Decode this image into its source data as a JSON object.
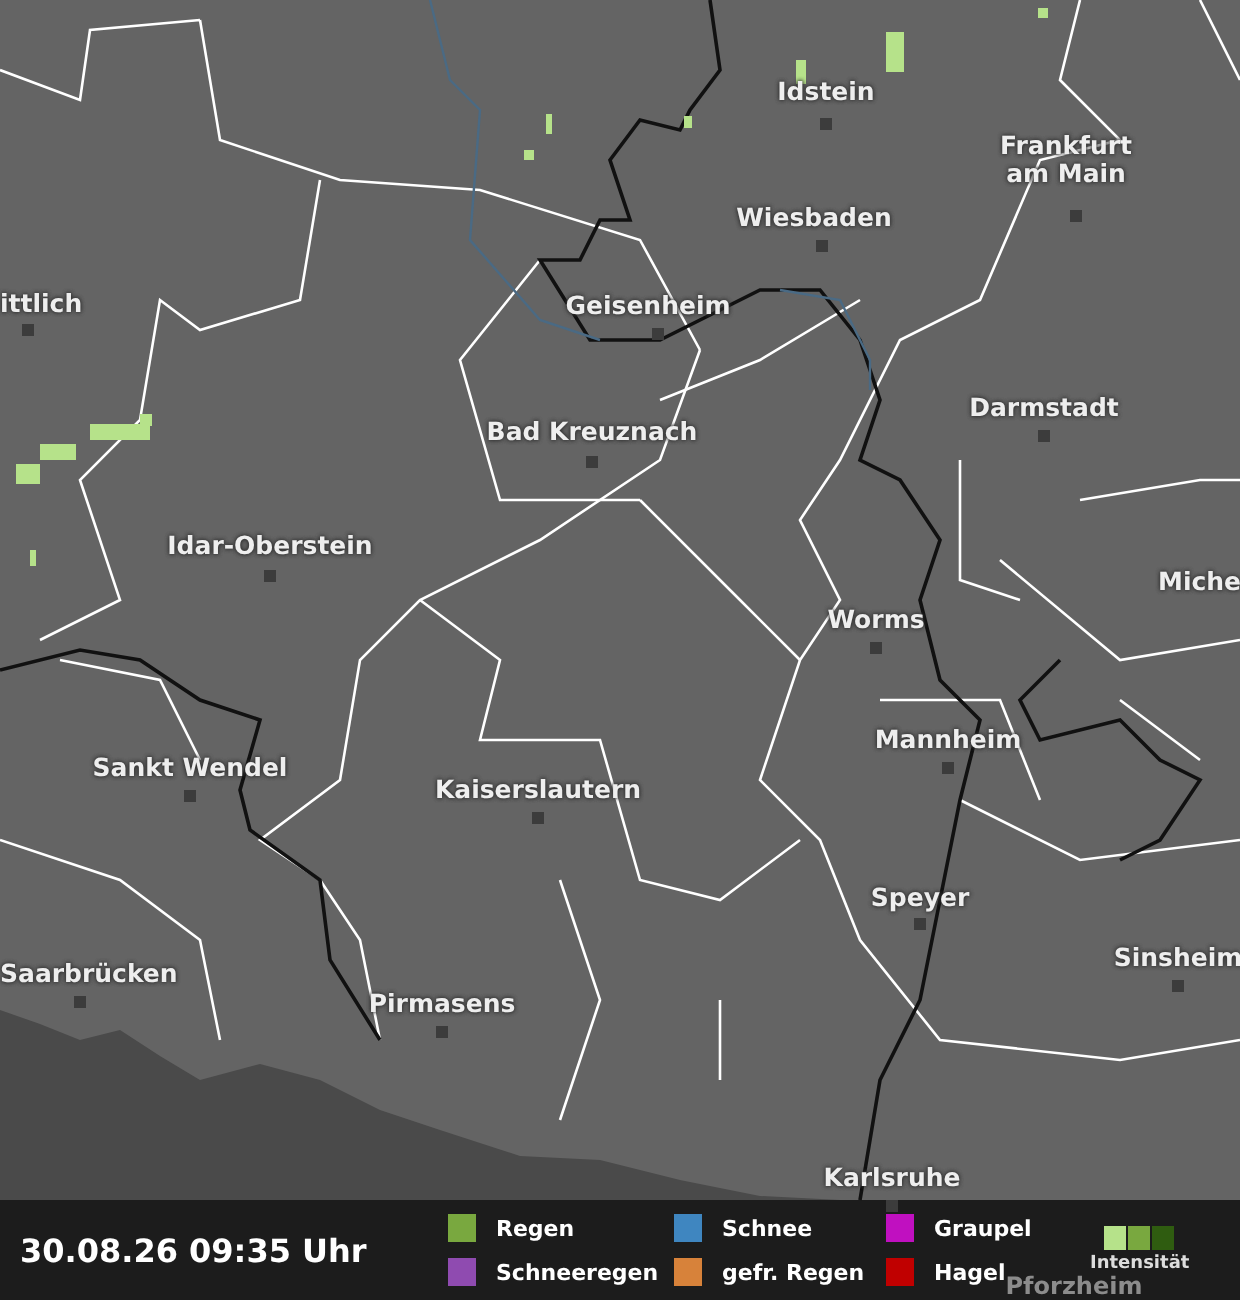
{
  "map": {
    "cities": [
      {
        "name": "Idstein"
      },
      {
        "name": "Frankfurt am Main"
      },
      {
        "name": "Wiesbaden"
      },
      {
        "name": "Geisenheim"
      },
      {
        "name": "ittlich"
      },
      {
        "name": "Darmstadt"
      },
      {
        "name": "Bad Kreuznach"
      },
      {
        "name": "Miche"
      },
      {
        "name": "Idar-Oberstein"
      },
      {
        "name": "Worms"
      },
      {
        "name": "Mannheim"
      },
      {
        "name": "Sankt Wendel"
      },
      {
        "name": "Kaiserslautern"
      },
      {
        "name": "Speyer"
      },
      {
        "name": "Sinsheim"
      },
      {
        "name": "Saarbrücken"
      },
      {
        "name": "Pirmasens"
      },
      {
        "name": "Karlsruhe"
      },
      {
        "name": "Pforzheim"
      }
    ]
  },
  "footer": {
    "timestamp": "30.08.26 09:35 Uhr",
    "legend": [
      {
        "label": "Regen",
        "color": "#79a83f"
      },
      {
        "label": "Schneeregen",
        "color": "#8f4bb0"
      },
      {
        "label": "Schnee",
        "color": "#3f86c0"
      },
      {
        "label": "gefr. Regen",
        "color": "#d7823a"
      },
      {
        "label": "Graupel",
        "color": "#c010c0"
      },
      {
        "label": "Hagel",
        "color": "#c00000"
      }
    ],
    "intensity": {
      "label": "Intensität",
      "swatches": [
        {
          "color": "#b6e28a"
        },
        {
          "color": "#79a83f"
        },
        {
          "color": "#2f5c10"
        }
      ]
    }
  }
}
